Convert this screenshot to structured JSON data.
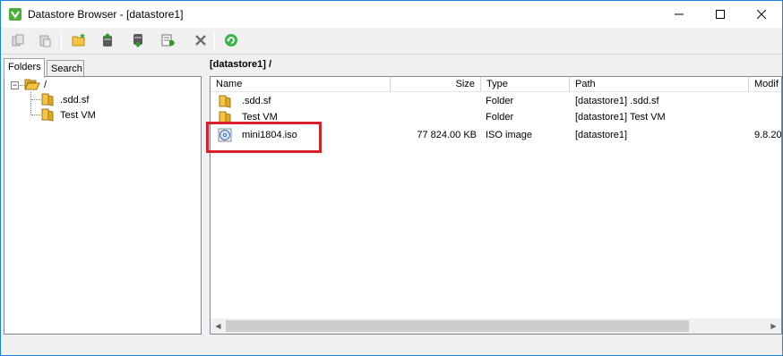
{
  "window": {
    "title": "Datastore Browser - [datastore1]",
    "accent": "#1883d7"
  },
  "toolbar": {
    "buttons": [
      {
        "name": "copy-icon",
        "enabled": false
      },
      {
        "name": "paste-icon",
        "enabled": false
      },
      {
        "name": "new-folder-icon",
        "enabled": true
      },
      {
        "name": "upload-icon",
        "enabled": true
      },
      {
        "name": "download-icon",
        "enabled": true
      },
      {
        "name": "register-vm-icon",
        "enabled": true
      },
      {
        "name": "delete-icon",
        "enabled": true
      },
      {
        "name": "refresh-icon",
        "enabled": true
      }
    ]
  },
  "left_panel": {
    "tabs": [
      {
        "label": "Folders",
        "active": true
      },
      {
        "label": "Search",
        "active": false
      }
    ],
    "tree": {
      "root_label": "/",
      "root_expander": "−",
      "children": [
        ".sdd.sf",
        "Test VM"
      ]
    }
  },
  "right_panel": {
    "path": "[datastore1] /",
    "columns": [
      "Name",
      "Size",
      "Type",
      "Path",
      "Modif"
    ],
    "rows": [
      {
        "icon": "folder-icon",
        "name": ".sdd.sf",
        "size": "",
        "type": "Folder",
        "path": "[datastore1] .sdd.sf",
        "modified": ""
      },
      {
        "icon": "folder-icon",
        "name": "Test VM",
        "size": "",
        "type": "Folder",
        "path": "[datastore1] Test VM",
        "modified": ""
      },
      {
        "icon": "iso-disc-icon",
        "name": "mini1804.iso",
        "size": "77 824.00 KB",
        "type": "ISO image",
        "path": "[datastore1]",
        "modified": "9.8.20"
      }
    ],
    "highlight_color": "#d9202c"
  }
}
